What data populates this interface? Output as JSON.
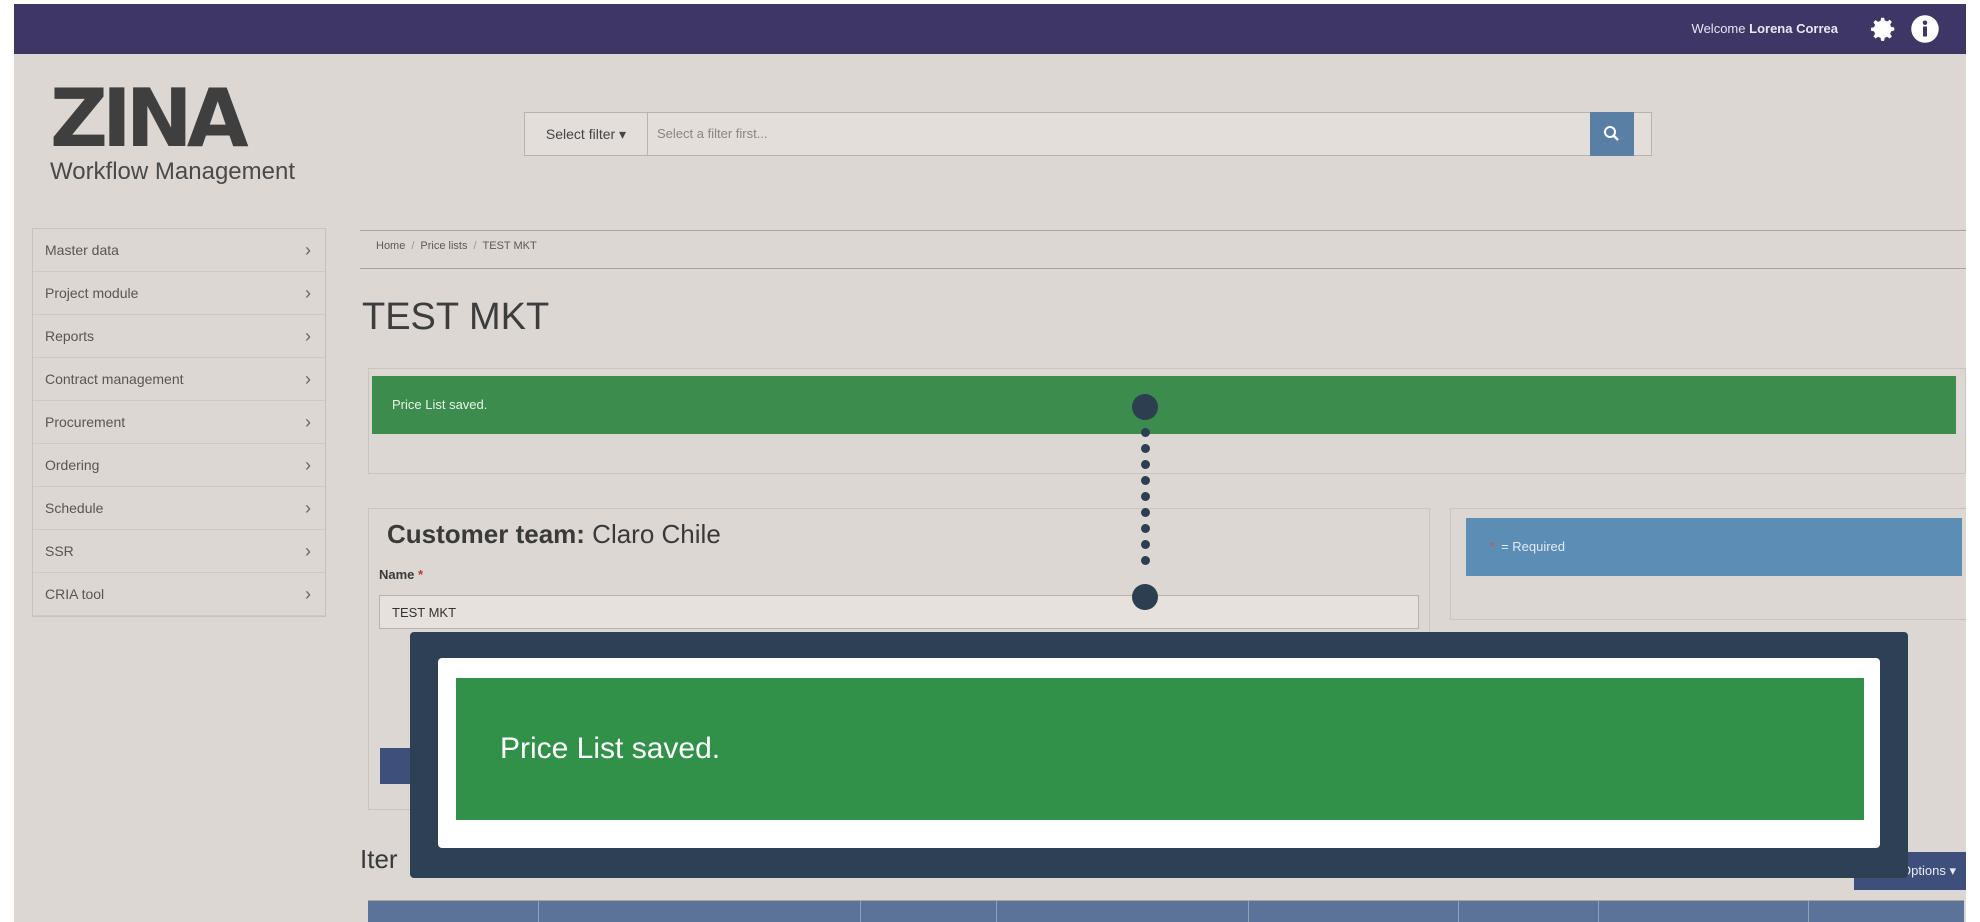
{
  "topbar": {
    "welcome_text": "Welcome",
    "user_name": "Lorena Correa"
  },
  "logo": {
    "brand": "ZINA",
    "subtitle": "Workflow Management"
  },
  "filter": {
    "button_label": "Select filter ▾",
    "placeholder": "Select a filter first..."
  },
  "sidebar": {
    "items": [
      {
        "label": "Master data"
      },
      {
        "label": "Project module"
      },
      {
        "label": "Reports"
      },
      {
        "label": "Contract management"
      },
      {
        "label": "Procurement"
      },
      {
        "label": "Ordering"
      },
      {
        "label": "Schedule"
      },
      {
        "label": "SSR"
      },
      {
        "label": "CRIA tool"
      }
    ]
  },
  "breadcrumb": {
    "home": "Home",
    "price_lists": "Price lists",
    "current": "TEST MKT"
  },
  "page": {
    "title": "TEST MKT"
  },
  "alert": {
    "message": "Price List saved."
  },
  "customer": {
    "title_label": "Customer team:",
    "title_value": "Claro Chile",
    "name_label": "Name",
    "name_required": "*",
    "name_value": "TEST MKT"
  },
  "required_note": {
    "star": "*",
    "text": "= Required"
  },
  "items_section": {
    "title_partial": "Iter",
    "options_label": "Options ▾"
  },
  "overlay": {
    "message": "Price List saved."
  },
  "colors": {
    "topbar": "#3e3664",
    "success": "#319149",
    "info": "#5b8db5",
    "callout": "#2d4054"
  }
}
